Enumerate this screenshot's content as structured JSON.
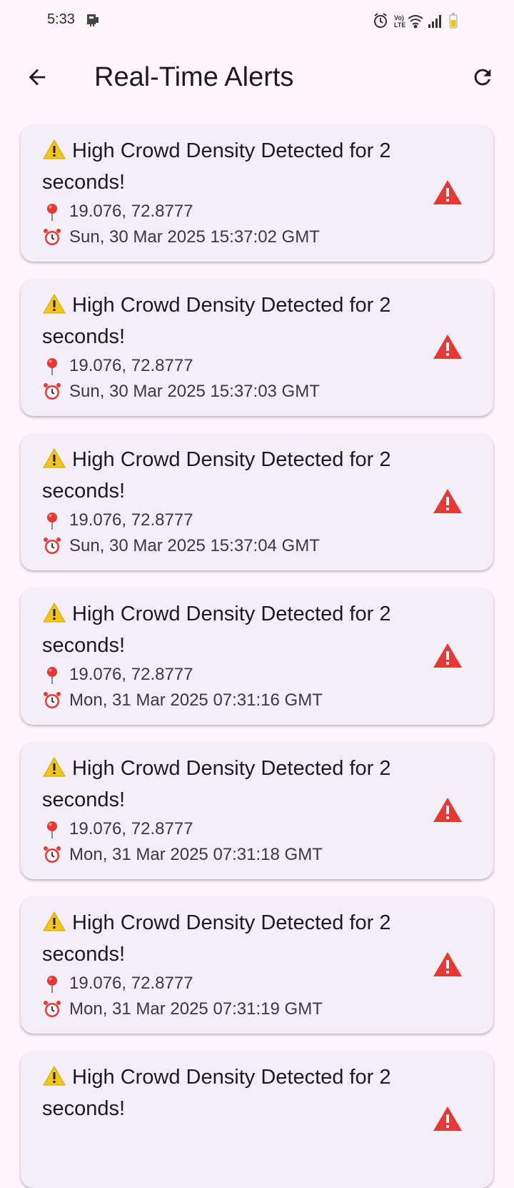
{
  "status_bar": {
    "time": "5:33",
    "icons": [
      "notification-icon",
      "alarm-icon",
      "volte-icon",
      "wifi-icon",
      "signal-icon",
      "battery-icon"
    ]
  },
  "app_bar": {
    "title": "Real-Time Alerts",
    "back_icon": "arrow-back-icon",
    "refresh_icon": "refresh-icon"
  },
  "colors": {
    "background": "#fdf7fc",
    "card": "#f4eff6",
    "alert_red": "#e53935",
    "warning_yellow": "#f5c518"
  },
  "alerts": [
    {
      "title": "High Crowd Density Detected for 2 seconds!",
      "location": "19.076, 72.8777",
      "time": "Sun, 30 Mar 2025 15:37:02 GMT"
    },
    {
      "title": "High Crowd Density Detected for 2 seconds!",
      "location": "19.076, 72.8777",
      "time": "Sun, 30 Mar 2025 15:37:03 GMT"
    },
    {
      "title": "High Crowd Density Detected for 2 seconds!",
      "location": "19.076, 72.8777",
      "time": "Sun, 30 Mar 2025 15:37:04 GMT"
    },
    {
      "title": "High Crowd Density Detected for 2 seconds!",
      "location": "19.076, 72.8777",
      "time": "Mon, 31 Mar 2025 07:31:16 GMT"
    },
    {
      "title": "High Crowd Density Detected for 2 seconds!",
      "location": "19.076, 72.8777",
      "time": "Mon, 31 Mar 2025 07:31:18 GMT"
    },
    {
      "title": "High Crowd Density Detected for 2 seconds!",
      "location": "19.076, 72.8777",
      "time": "Mon, 31 Mar 2025 07:31:19 GMT"
    },
    {
      "title": "High Crowd Density Detected for 2 seconds!",
      "location": "",
      "time": ""
    }
  ]
}
